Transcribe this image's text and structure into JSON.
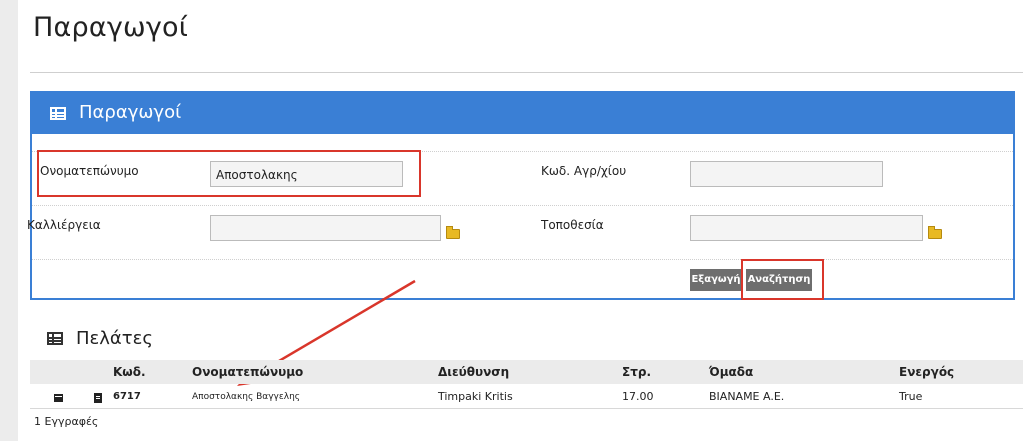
{
  "page": {
    "title": "Παραγωγοί"
  },
  "filters": {
    "title": "Παραγωγοί",
    "name_label": "Ονοματεπώνυμο",
    "name_value": "Αποστολακης",
    "code_label": "Κωδ. Αγρ/χίου",
    "code_value": "",
    "crop_label": "Καλλιέργεια",
    "crop_value": "",
    "location_label": "Τοποθεσία",
    "location_value": "",
    "export_label": "Εξαγωγή",
    "search_label": "Αναζήτηση"
  },
  "clients": {
    "title": "Πελάτες",
    "columns": [
      "Κωδ.",
      "Ονοματεπώνυμο",
      "Διεύθυνση",
      "Στρ.",
      "Όμαδα",
      "Ενεργός"
    ],
    "rows": [
      {
        "code": "6717",
        "name": "Αποστολακης Βαγγελης",
        "address": "Timpaki Kritis",
        "stremmata": "17.00",
        "group": "BIANAME A.E.",
        "active": "True"
      }
    ],
    "footer": "1 Εγγραφές"
  },
  "colors": {
    "panel_header": "#3a7fd5",
    "button": "#6e6e6e",
    "highlight": "#d9362b"
  }
}
